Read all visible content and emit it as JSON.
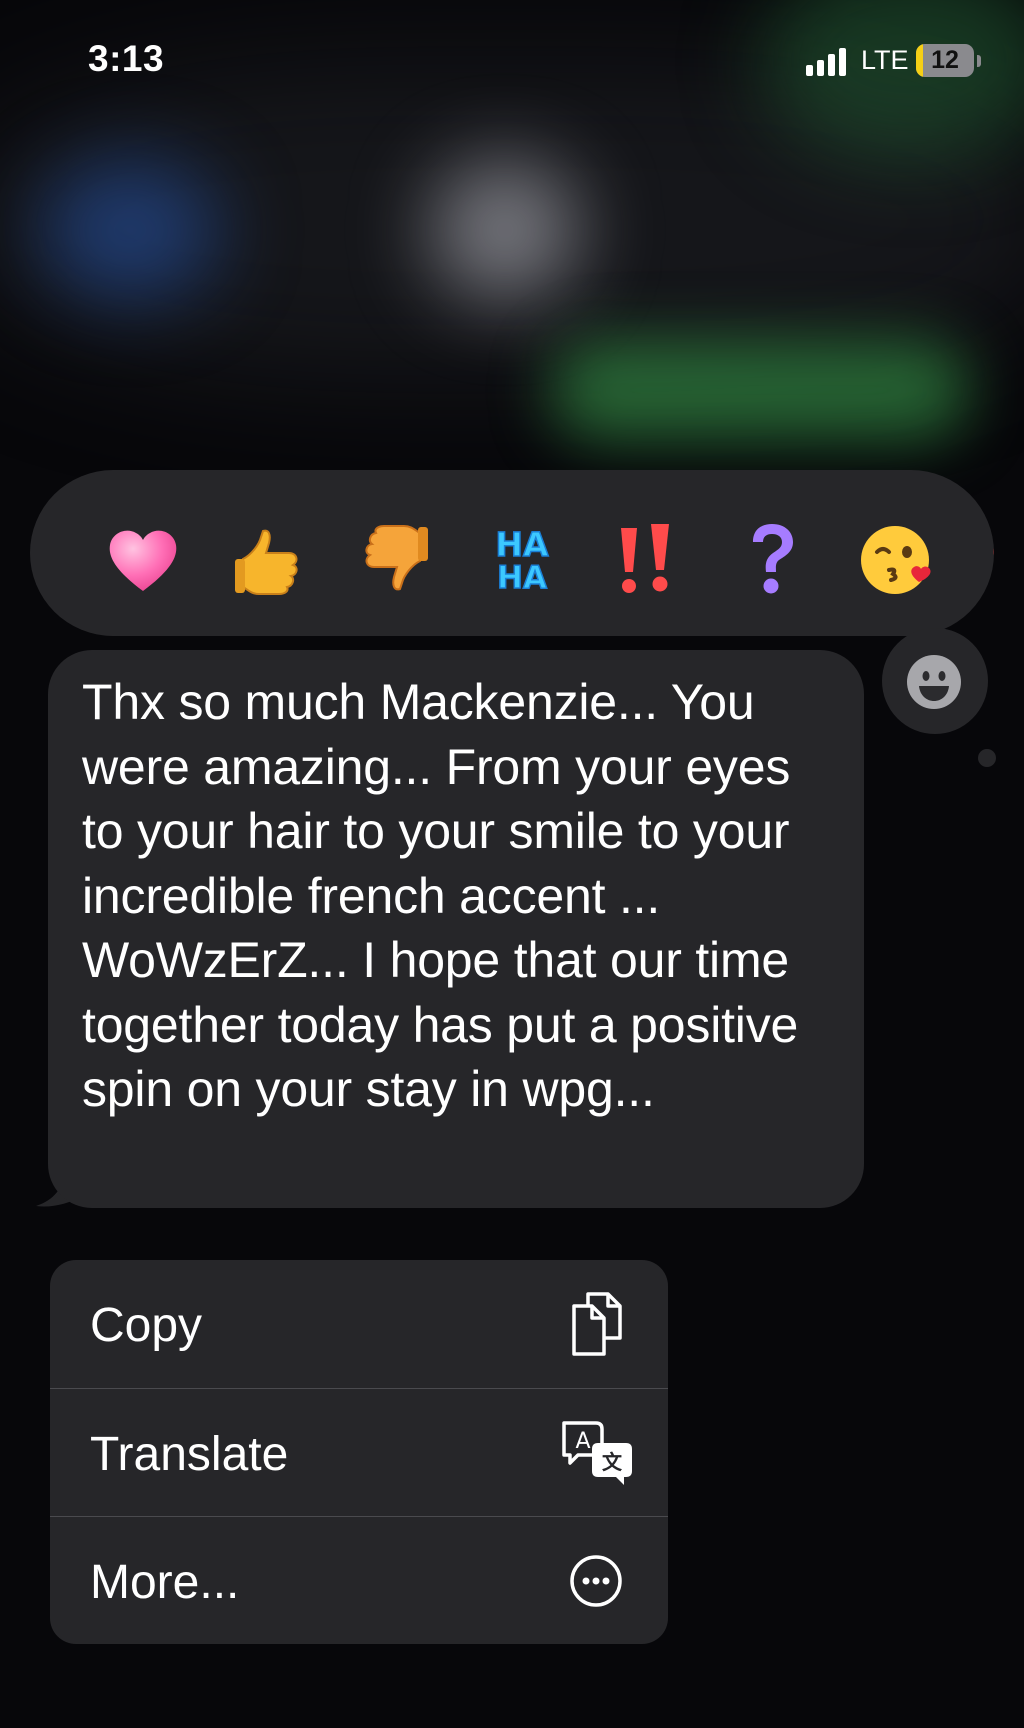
{
  "status_bar": {
    "time": "3:13",
    "network": "LTE",
    "battery_level": "12",
    "battery_fraction": 0.12
  },
  "tapback": {
    "reactions": [
      {
        "name": "heart",
        "icon": "heart-icon"
      },
      {
        "name": "thumbs-up",
        "icon": "thumbs-up-icon"
      },
      {
        "name": "thumbs-down",
        "icon": "thumbs-down-icon"
      },
      {
        "name": "haha",
        "icon": "haha-icon",
        "text_top": "HA",
        "text_bottom": "HA"
      },
      {
        "name": "emphasize",
        "icon": "double-exclamation-icon"
      },
      {
        "name": "question",
        "icon": "question-mark-icon"
      },
      {
        "name": "kissing-face",
        "icon": "kissing-face-icon"
      }
    ]
  },
  "message": {
    "text": "Thx so much Mackenzie... You were amazing... From your eyes to your hair to your smile to your incredible french accent ... WoWzErZ... I hope that our time together today has put a positive spin on your stay in wpg..."
  },
  "menu": {
    "items": [
      {
        "label": "Copy",
        "icon": "copy-icon"
      },
      {
        "label": "Translate",
        "icon": "translate-icon"
      },
      {
        "label": "More...",
        "icon": "more-icon"
      }
    ]
  },
  "colors": {
    "bubble": "#262629",
    "heart": "#ff5fa8",
    "thumb": "#f7b52c",
    "haha": "#38c4ff",
    "exclaim": "#ff4b4b",
    "question": "#a67cff"
  }
}
